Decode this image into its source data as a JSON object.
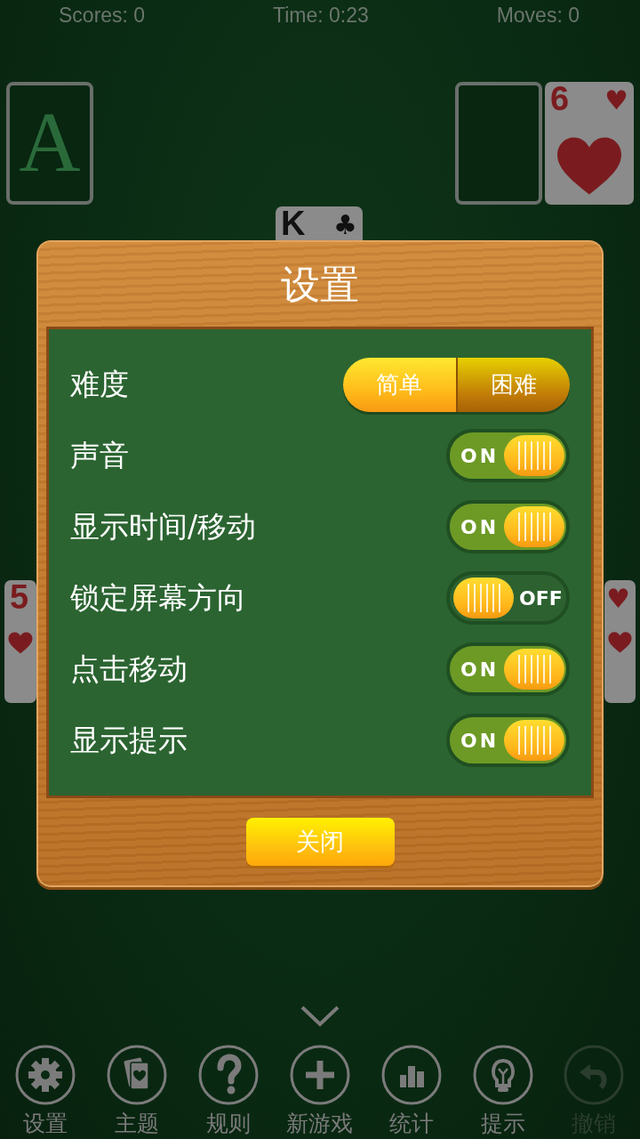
{
  "status": {
    "scores": "Scores: 0",
    "time": "Time: 0:23",
    "moves": "Moves: 0"
  },
  "cards": [
    {
      "kind": "placeholder",
      "rank": "A"
    },
    {
      "kind": "empty"
    },
    {
      "kind": "pip_card",
      "rank": "6",
      "suit": "♥",
      "color": "#7a1c1f"
    },
    {
      "kind": "face",
      "rank": "K",
      "suit": "♣",
      "color": "#111111"
    },
    {
      "kind": "pip_card",
      "rank": "5",
      "color": "#7a1c1f"
    },
    {
      "kind": "pip_card",
      "suit": "♥",
      "color": "#7a1c1f"
    }
  ],
  "dialog": {
    "title": "设置",
    "rows": [
      {
        "kind": "segmented",
        "label": "难度",
        "options": [
          {
            "label": "简单",
            "selected": true
          },
          {
            "label": "困难",
            "selected": false
          }
        ]
      },
      {
        "kind": "toggle",
        "label": "声音",
        "on": true,
        "state_label": "ON"
      },
      {
        "kind": "toggle",
        "label": "显示时间/移动",
        "on": true,
        "state_label": "ON"
      },
      {
        "kind": "toggle",
        "label": "锁定屏幕方向",
        "on": false,
        "state_label": "OFF"
      },
      {
        "kind": "toggle",
        "label": "点击移动",
        "on": true,
        "state_label": "ON"
      },
      {
        "kind": "toggle",
        "label": "显示提示",
        "on": true,
        "state_label": "ON"
      }
    ],
    "close": "关闭"
  },
  "toolbar": [
    {
      "kind": "gear",
      "label": "设置",
      "disabled": false
    },
    {
      "kind": "theme",
      "label": "主题",
      "disabled": false
    },
    {
      "kind": "help",
      "label": "规则",
      "disabled": false
    },
    {
      "kind": "plus",
      "label": "新游戏",
      "disabled": false
    },
    {
      "kind": "stats",
      "label": "统计",
      "disabled": false
    },
    {
      "kind": "bulb",
      "label": "提示",
      "disabled": false
    },
    {
      "kind": "undo",
      "label": "撤销",
      "disabled": true
    }
  ]
}
